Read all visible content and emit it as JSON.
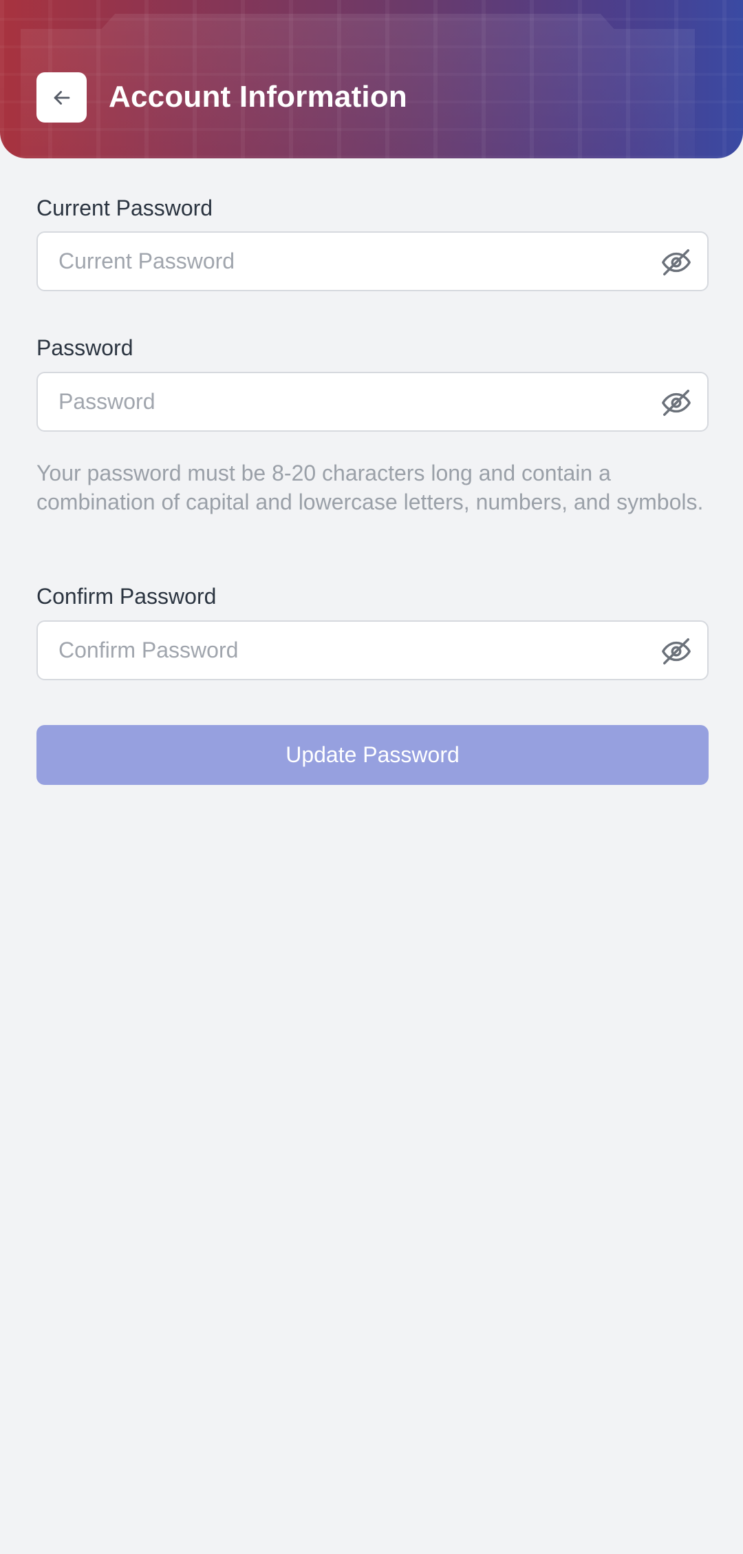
{
  "header": {
    "title": "Account Information",
    "back_icon": "arrow-left-icon",
    "gradient_colors": [
      "#a8333f",
      "#6b3a6a",
      "#3a4aa3"
    ]
  },
  "form": {
    "current_password": {
      "label": "Current Password",
      "placeholder": "Current Password",
      "value": "",
      "toggle_icon": "eye-off-icon"
    },
    "password": {
      "label": "Password",
      "placeholder": "Password",
      "value": "",
      "toggle_icon": "eye-off-icon"
    },
    "hint": "Your password must be 8-20 characters long and contain a combination of capital and lowercase letters, numbers, and symbols.",
    "confirm_password": {
      "label": "Confirm Password",
      "placeholder": "Confirm Password",
      "value": "",
      "toggle_icon": "eye-off-icon"
    },
    "submit_label": "Update Password",
    "submit_color": "#96a0df"
  }
}
